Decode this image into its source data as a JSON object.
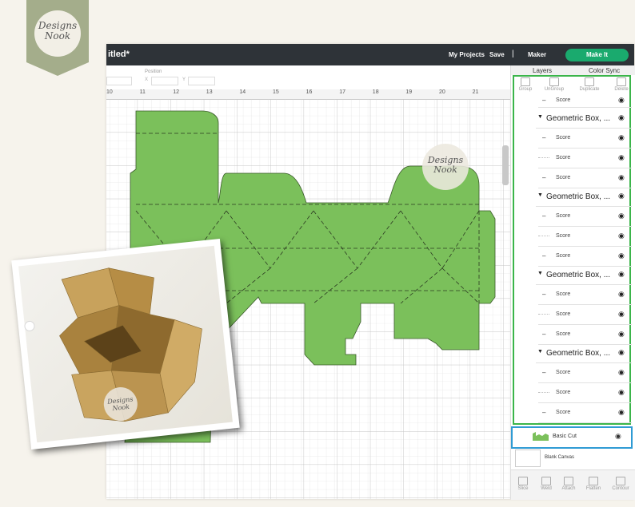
{
  "logo": {
    "line1": "Designs",
    "line2": "Nook"
  },
  "topbar": {
    "title": "itled*",
    "my_projects": "My Projects",
    "save": "Save",
    "separator": "|",
    "machine": "Maker",
    "make_it": "Make It"
  },
  "subbar": {
    "position_label": "Position",
    "x_label": "X",
    "y_label": "Y"
  },
  "ruler": [
    "10",
    "11",
    "12",
    "13",
    "14",
    "15",
    "16",
    "17",
    "18",
    "19",
    "20",
    "21"
  ],
  "panel": {
    "tabs": {
      "layers": "Layers",
      "color_sync": "Color Sync"
    },
    "tools": [
      "Group",
      "UnGroup",
      "Duplicate",
      "Delete"
    ],
    "first_score": "Score",
    "groups": [
      {
        "name": "Geometric Box, ...",
        "items": [
          "Score",
          "Score",
          "Score"
        ]
      },
      {
        "name": "Geometric Box, ...",
        "items": [
          "Score",
          "Score",
          "Score"
        ]
      },
      {
        "name": "Geometric Box, ...",
        "items": [
          "Score",
          "Score",
          "Score"
        ]
      },
      {
        "name": "Geometric Box, ...",
        "items": [
          "Score",
          "Score",
          "Score"
        ]
      }
    ],
    "basic_cut": "Basic Cut",
    "blank_canvas": "Blank Canvas",
    "bottom_tools": [
      "Slice",
      "Weld",
      "Attach",
      "Flatten",
      "Contour"
    ]
  },
  "watermark": {
    "line1": "Designs",
    "line2": "Nook"
  },
  "colors": {
    "topbar": "#2e3338",
    "accent": "#1aaa6e",
    "shape": "#7bc05b",
    "layers_outline": "#3bb54a",
    "selected_outline": "#2f9bd4"
  }
}
